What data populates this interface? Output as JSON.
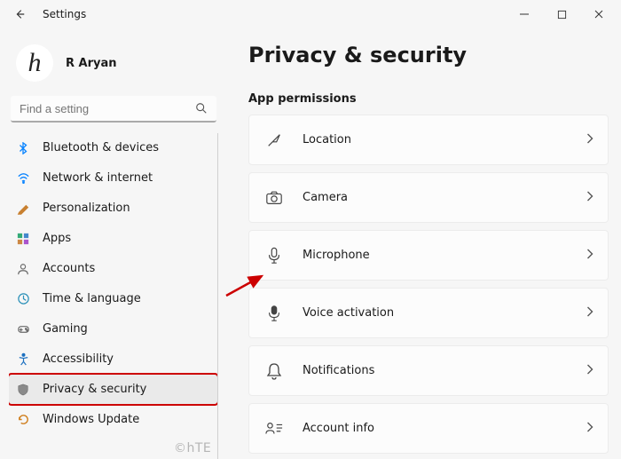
{
  "window": {
    "back_tip": "Back",
    "title": "Settings",
    "min_tip": "Minimize",
    "max_tip": "Maximize",
    "close_tip": "Close"
  },
  "profile": {
    "avatar_letter": "h",
    "name": "R Aryan"
  },
  "search": {
    "placeholder": "Find a setting"
  },
  "sidebar": {
    "items": [
      {
        "id": "bluetooth",
        "label": "Bluetooth & devices"
      },
      {
        "id": "network",
        "label": "Network & internet"
      },
      {
        "id": "personalization",
        "label": "Personalization"
      },
      {
        "id": "apps",
        "label": "Apps"
      },
      {
        "id": "accounts",
        "label": "Accounts"
      },
      {
        "id": "time",
        "label": "Time & language"
      },
      {
        "id": "gaming",
        "label": "Gaming"
      },
      {
        "id": "accessibility",
        "label": "Accessibility"
      },
      {
        "id": "privacy",
        "label": "Privacy & security"
      },
      {
        "id": "update",
        "label": "Windows Update"
      }
    ],
    "selected_index": 8
  },
  "main": {
    "title": "Privacy & security",
    "section_label": "App permissions",
    "permissions": [
      {
        "id": "location",
        "label": "Location"
      },
      {
        "id": "camera",
        "label": "Camera"
      },
      {
        "id": "microphone",
        "label": "Microphone"
      },
      {
        "id": "voice",
        "label": "Voice activation"
      },
      {
        "id": "notifications",
        "label": "Notifications"
      },
      {
        "id": "account",
        "label": "Account info"
      }
    ],
    "highlight_index": 2
  },
  "watermark": "©hTE"
}
